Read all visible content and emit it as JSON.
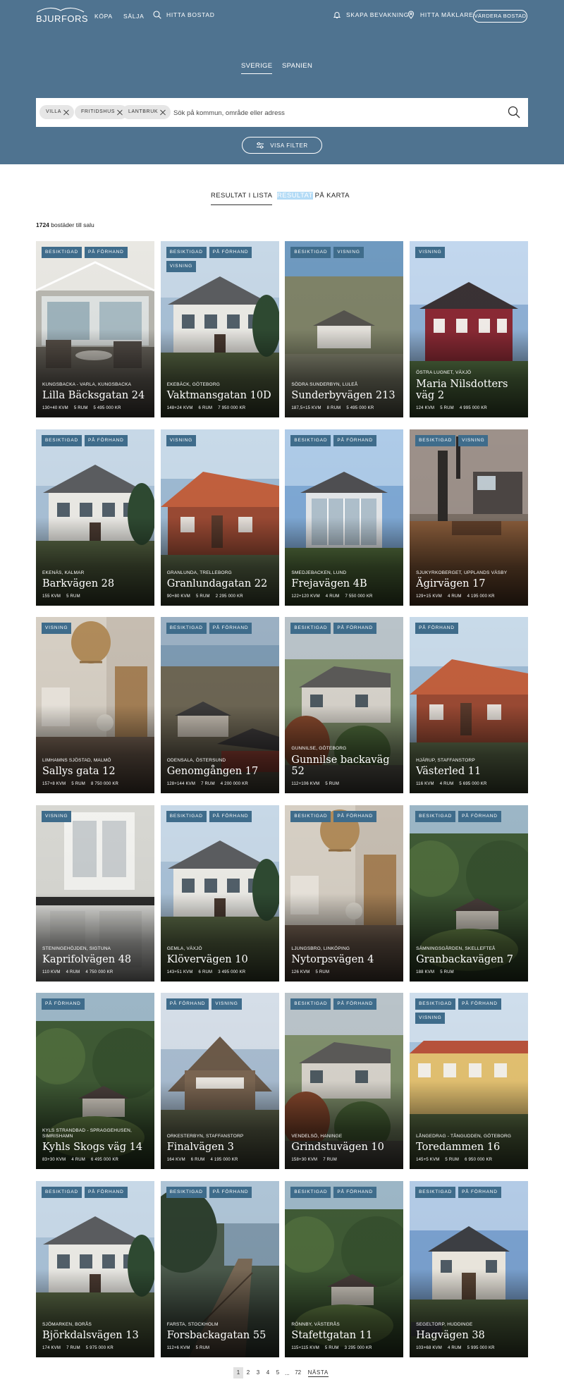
{
  "header": {
    "logo_text": "BJURFORS",
    "nav": {
      "buy": "KÖPA",
      "sell": "SÄLJA",
      "find": "HITTA BOSTAD"
    },
    "actions": {
      "watch": "SKAPA BEVAKNING",
      "agent": "HITTA MÄKLARE",
      "valuation": "VÄRDERA BOSTAD"
    }
  },
  "markets": [
    "SVERIGE",
    "SPANIEN"
  ],
  "search": {
    "chips": [
      "VILLA",
      "FRITIDSHUS",
      "LANTBRUK"
    ],
    "placeholder": "Sök på kommun, område eller adress",
    "filter_label": "VISA FILTER"
  },
  "view": {
    "list_tab": "RESULTAT I LISTA",
    "map_tab_highlight": "RESULTAT",
    "map_tab_rest": " PÅ KARTA",
    "count_number": "1724",
    "count_suffix": " bostäder till salu"
  },
  "listings": [
    {
      "badges": [
        "BESIKTIGAD",
        "PÅ FÖRHAND"
      ],
      "area": "KUNGSBACKA - VARLA, KUNGSBACKA",
      "title": "Lilla Bäcksgatan 24",
      "size": "130+40 KVM",
      "rooms": "5 RUM",
      "price": "5 495 000 KR",
      "scene": "interior"
    },
    {
      "badges": [
        "BESIKTIGAD",
        "PÅ FÖRHAND",
        "VISNING"
      ],
      "area": "EKEBÄCK, GÖTEBORG",
      "title": "Vaktmansgatan 10D",
      "size": "148+24 KVM",
      "rooms": "6 RUM",
      "price": "7 950 000 KR",
      "scene": "house-white"
    },
    {
      "badges": [
        "BESIKTIGAD",
        "VISNING"
      ],
      "area": "SÖDRA SUNDERBYN, LULEÅ",
      "title": "Sunderbyvägen 213",
      "size": "187,5+15 KVM",
      "rooms": "8 RUM",
      "price": "5 495 000 KR",
      "scene": "house-aerial"
    },
    {
      "badges": [
        "VISNING"
      ],
      "area": "ÖSTRA LUGNET, VÄXJÖ",
      "title": "Maria Nilsdotters väg 2",
      "size": "124 KVM",
      "rooms": "5 RUM",
      "price": "4 995 000 KR",
      "scene": "house-red"
    },
    {
      "badges": [
        "BESIKTIGAD",
        "PÅ FÖRHAND"
      ],
      "area": "EKENÄS, KALMAR",
      "title": "Barkvägen 28",
      "size": "155 KVM",
      "rooms": "5 RUM",
      "price": "",
      "scene": "house-white"
    },
    {
      "badges": [
        "VISNING"
      ],
      "area": "GRANLUNDA, TRELLEBORG",
      "title": "Granlundagatan 22",
      "size": "90+80 KVM",
      "rooms": "5 RUM",
      "price": "2 295 000 KR",
      "scene": "house-brick"
    },
    {
      "badges": [
        "BESIKTIGAD",
        "PÅ FÖRHAND"
      ],
      "area": "SMEDJEBACKEN, LUND",
      "title": "Frejavägen 4B",
      "size": "122+120 KVM",
      "rooms": "4 RUM",
      "price": "7 550 000 KR",
      "scene": "house-glass"
    },
    {
      "badges": [
        "BESIKTIGAD",
        "VISNING"
      ],
      "area": "SJUKYRKOBERGET, UPPLANDS VÄSBY",
      "title": "Ägirvägen 17",
      "size": "129+15 KVM",
      "rooms": "4 RUM",
      "price": "4 195 000 KR",
      "scene": "interior-dark"
    },
    {
      "badges": [
        "VISNING"
      ],
      "area": "LIMHAMNS SJÖSTAD, MALMÖ",
      "title": "Sallys gata 12",
      "size": "157+8 KVM",
      "rooms": "5 RUM",
      "price": "8 750 000 KR",
      "scene": "interior-warm"
    },
    {
      "badges": [
        "BESIKTIGAD",
        "PÅ FÖRHAND"
      ],
      "area": "ODENSALA, ÖSTERSUND",
      "title": "Genomgången 17",
      "size": "128+144 KVM",
      "rooms": "7 RUM",
      "price": "4 200 000 KR",
      "scene": "town-lake"
    },
    {
      "badges": [
        "BESIKTIGAD",
        "PÅ FÖRHAND"
      ],
      "area": "GUNNILSE, GÖTEBORG",
      "title": "Gunnilse backaväg 52",
      "size": "112+106 KVM",
      "rooms": "5 RUM",
      "price": "",
      "scene": "house-garden"
    },
    {
      "badges": [
        "PÅ FÖRHAND"
      ],
      "area": "HJÄRUP, STAFFANSTORP",
      "title": "Västerled 11",
      "size": "116 KVM",
      "rooms": "4 RUM",
      "price": "5 695 000 KR",
      "scene": "house-brick"
    },
    {
      "badges": [
        "VISNING"
      ],
      "area": "STENINGEHÖJDEN, SIGTUNA",
      "title": "Kaprifolvägen 48",
      "size": "110 KVM",
      "rooms": "4 RUM",
      "price": "4 750 000 KR",
      "scene": "kitchen"
    },
    {
      "badges": [
        "BESIKTIGAD",
        "PÅ FÖRHAND"
      ],
      "area": "GEMLA, VÄXJÖ",
      "title": "Klövervägen 10",
      "size": "143+51 KVM",
      "rooms": "6 RUM",
      "price": "3 495 000 KR",
      "scene": "house-white"
    },
    {
      "badges": [
        "BESIKTIGAD",
        "PÅ FÖRHAND"
      ],
      "area": "LJUNGSBRO, LINKÖPING",
      "title": "Nytorpsvägen 4",
      "size": "126 KVM",
      "rooms": "5 RUM",
      "price": "",
      "scene": "interior-warm"
    },
    {
      "badges": [
        "BESIKTIGAD",
        "PÅ FÖRHAND"
      ],
      "area": "SÄMNINGSGÅRDEN, SKELLEFTEÅ",
      "title": "Granbackavägen 7",
      "size": "188 KVM",
      "rooms": "5 RUM",
      "price": "",
      "scene": "forest-aerial"
    },
    {
      "badges": [
        "PÅ FÖRHAND"
      ],
      "area": "KYLS STRANDBAD - SPRAGGEHUSEN, SIMRISHAMN",
      "title": "Kyhls Skogs väg 14",
      "size": "83+30 KVM",
      "rooms": "4 RUM",
      "price": "6 495 000 KR",
      "scene": "forest-aerial"
    },
    {
      "badges": [
        "PÅ FÖRHAND",
        "VISNING"
      ],
      "area": "ORKESTERBYN, STAFFANSTORP",
      "title": "Finalvägen 3",
      "size": "164 KVM",
      "rooms": "6 RUM",
      "price": "4 195 000 KR",
      "scene": "house-wood"
    },
    {
      "badges": [
        "BESIKTIGAD",
        "PÅ FÖRHAND"
      ],
      "area": "VENDELSÖ, HANINGE",
      "title": "Grindstuvägen 10",
      "size": "158+30 KVM",
      "rooms": "7 RUM",
      "price": "",
      "scene": "house-garden"
    },
    {
      "badges": [
        "BESIKTIGAD",
        "PÅ FÖRHAND",
        "VISNING"
      ],
      "area": "LÅNGEDRAG - TÅNGUDDEN, GÖTEBORG",
      "title": "Toredammen 16",
      "size": "145+5 KVM",
      "rooms": "5 RUM",
      "price": "6 950 000 KR",
      "scene": "house-yellow"
    },
    {
      "badges": [
        "BESIKTIGAD",
        "PÅ FÖRHAND"
      ],
      "area": "SJÖMARKEN, BORÅS",
      "title": "Björkdalsvägen 13",
      "size": "174 KVM",
      "rooms": "7 RUM",
      "price": "5 975 000 KR",
      "scene": "house-white"
    },
    {
      "badges": [
        "BESIKTIGAD",
        "PÅ FÖRHAND"
      ],
      "area": "FARSTA, STOCKHOLM",
      "title": "Forsbackagatan 55",
      "size": "112+6 KVM",
      "rooms": "5 RUM",
      "price": "",
      "scene": "pier"
    },
    {
      "badges": [
        "BESIKTIGAD",
        "PÅ FÖRHAND"
      ],
      "area": "RÖNNBY, VÄSTERÅS",
      "title": "Stafettgatan 11",
      "size": "115+115 KVM",
      "rooms": "5 RUM",
      "price": "3 295 000 KR",
      "scene": "forest-aerial"
    },
    {
      "badges": [
        "BESIKTIGAD",
        "PÅ FÖRHAND"
      ],
      "area": "SEGELTORP, HUDDINGE",
      "title": "Hagvägen 38",
      "size": "103+68 KVM",
      "rooms": "4 RUM",
      "price": "5 995 000 KR",
      "scene": "house-villa"
    }
  ],
  "pagination": {
    "pages": [
      "1",
      "2",
      "3",
      "4",
      "5"
    ],
    "dots": "...",
    "last": "72",
    "next": "NÄSTA"
  },
  "colors": {
    "hero": "#4f7390",
    "badge": "#3f6c8b",
    "highlight": "#b3dbf6"
  },
  "icons": [
    "bell-icon",
    "pin-icon",
    "search-icon",
    "filter-icon",
    "close-icon"
  ]
}
